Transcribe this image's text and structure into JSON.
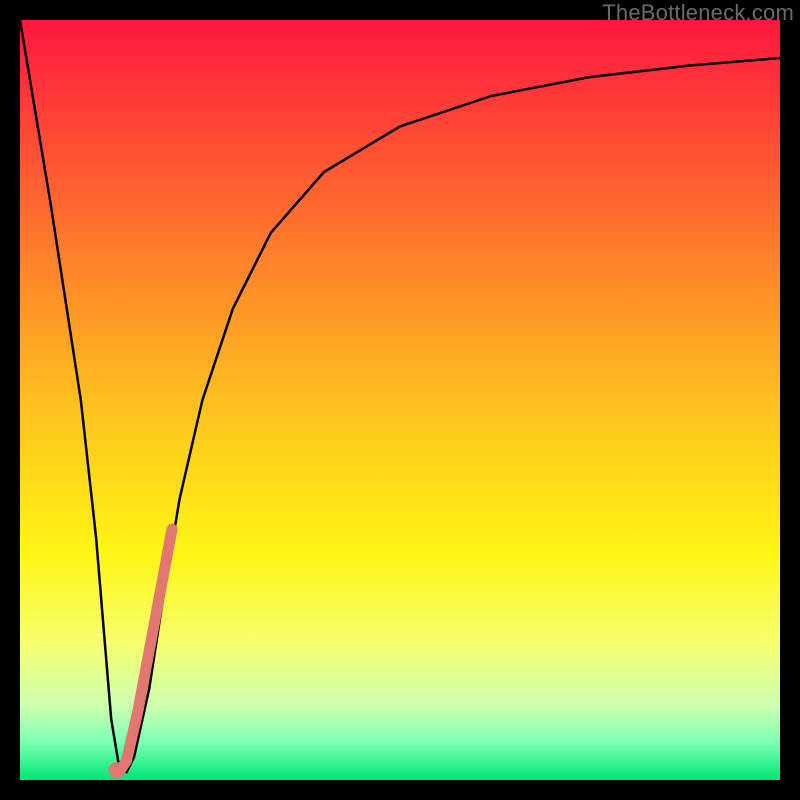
{
  "watermark": "TheBottleneck.com",
  "chart_data": {
    "type": "line",
    "title": "",
    "xlabel": "",
    "ylabel": "",
    "xlim": [
      0,
      100
    ],
    "ylim": [
      0,
      100
    ],
    "grid": false,
    "legend": false,
    "background": {
      "gradient_stops": [
        {
          "pos": 0.0,
          "color": "#ff173f"
        },
        {
          "pos": 0.25,
          "color": "#ff6b2e"
        },
        {
          "pos": 0.5,
          "color": "#ffbf1f"
        },
        {
          "pos": 0.7,
          "color": "#fff514"
        },
        {
          "pos": 0.82,
          "color": "#f6ff6e"
        },
        {
          "pos": 0.9,
          "color": "#cfffb0"
        },
        {
          "pos": 0.95,
          "color": "#7dffb4"
        },
        {
          "pos": 1.0,
          "color": "#00e676"
        }
      ]
    },
    "series": [
      {
        "name": "bottleneck-curve",
        "color": "#000000",
        "width": 2.5,
        "x": [
          0,
          2,
          4,
          6,
          8,
          10,
          11,
          12,
          13,
          14,
          15,
          17,
          19,
          21,
          24,
          28,
          33,
          40,
          50,
          62,
          75,
          88,
          100
        ],
        "y": [
          100,
          88,
          76,
          63,
          50,
          32,
          20,
          8,
          2,
          1,
          3,
          12,
          25,
          37,
          50,
          62,
          72,
          80,
          86,
          90,
          92.5,
          94,
          95
        ]
      },
      {
        "name": "highlight-segment",
        "color": "#e2776f",
        "width": 11,
        "linecap": "round",
        "x": [
          13.0,
          14.0,
          15.5,
          17.0,
          18.5,
          20.0
        ],
        "y": [
          1.0,
          2.5,
          9.0,
          17.0,
          25.0,
          33.0
        ]
      },
      {
        "name": "highlight-dot",
        "type": "scatter",
        "color": "#e2776f",
        "radius": 8,
        "x": [
          12.7
        ],
        "y": [
          1.3
        ]
      }
    ]
  }
}
